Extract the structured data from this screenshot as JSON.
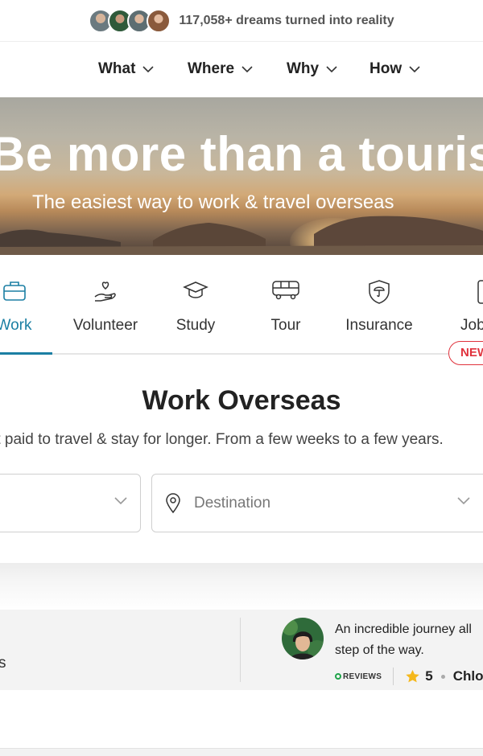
{
  "topbar": {
    "avatars": [
      "avatar-1",
      "avatar-2",
      "avatar-3",
      "avatar-4"
    ],
    "count_text": "117,058+ dreams turned into reality"
  },
  "nav": {
    "items": [
      {
        "label": "What",
        "icon": "chevron-down-icon"
      },
      {
        "label": "Where",
        "icon": "chevron-down-icon"
      },
      {
        "label": "Why",
        "icon": "chevron-down-icon"
      },
      {
        "label": "How",
        "icon": "chevron-down-icon"
      }
    ]
  },
  "hero": {
    "title": "Be more than a tourist",
    "subtitle": "The easiest way to work & travel overseas"
  },
  "categories": {
    "tabs": [
      {
        "label": "Work",
        "icon": "briefcase-icon",
        "active": true
      },
      {
        "label": "Volunteer",
        "icon": "heart-hand-icon",
        "active": false
      },
      {
        "label": "Study",
        "icon": "graduation-cap-icon",
        "active": false
      },
      {
        "label": "Tour",
        "icon": "bus-icon",
        "active": false
      },
      {
        "label": "Insurance",
        "icon": "shield-umbrella-icon",
        "active": false
      },
      {
        "label": "Jobs",
        "icon": "phone-icon",
        "active": false
      }
    ],
    "new_badge": "NEW"
  },
  "work": {
    "title": "Work Overseas",
    "subtitle": "Get paid to travel & stay for longer. From a few weeks to a few years.",
    "destination_placeholder": "Destination"
  },
  "review": {
    "quote": "An incredible journey all step of the way.",
    "source": "REVIEWS",
    "rating": "5",
    "name": "Chloe",
    "left_fragment": "s"
  },
  "colors": {
    "accent": "#1b7fa3",
    "new_badge": "#e0323c",
    "star": "#f5b81c",
    "reviews_green": "#1fa34a"
  }
}
